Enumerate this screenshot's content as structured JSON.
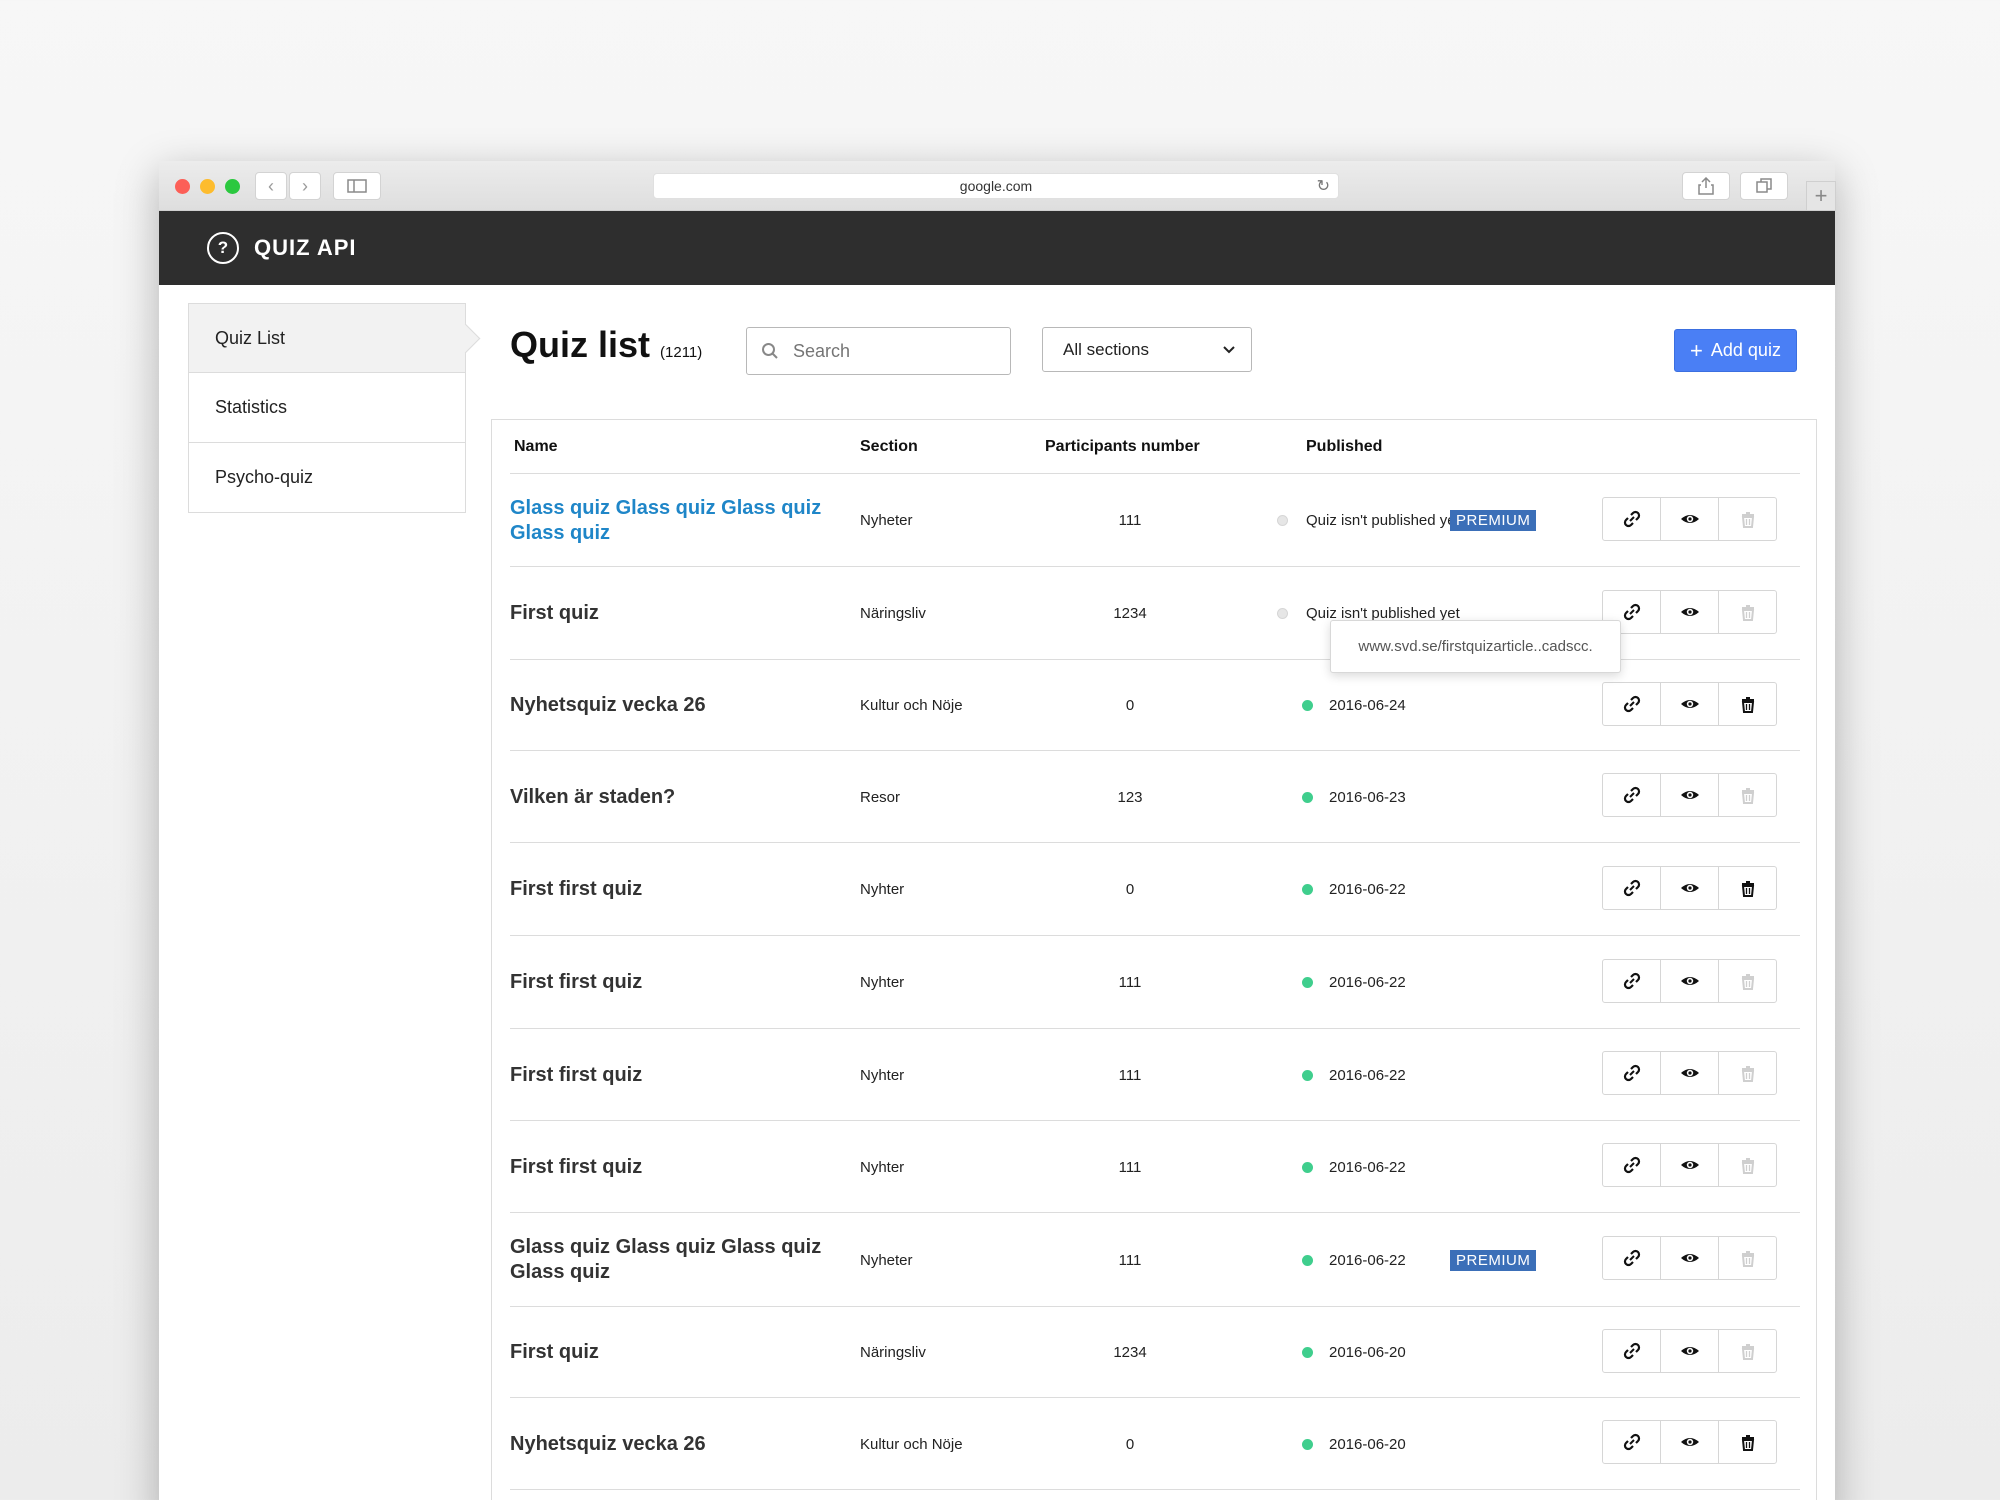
{
  "browser": {
    "url": "google.com"
  },
  "app": {
    "title": "QUIZ API",
    "logo_icon": "question-circle-icon"
  },
  "sidebar": {
    "items": [
      {
        "label": "Quiz List",
        "active": true
      },
      {
        "label": "Statistics",
        "active": false
      },
      {
        "label": "Psycho-quiz",
        "active": false
      }
    ]
  },
  "header": {
    "title": "Quiz list",
    "count": "(1211)",
    "search_placeholder": "Search",
    "section_filter": "All sections",
    "add_label": "Add quiz"
  },
  "table": {
    "columns": [
      "Name",
      "Section",
      "Participants number",
      "Published"
    ],
    "rows": [
      {
        "name": "Glass quiz Glass quiz Glass quiz Glass quiz",
        "section": "Nyheter",
        "participants": "111",
        "published": "Quiz isn't published yet",
        "status": "unpublished",
        "premium": "PREMIUM",
        "highlight": true,
        "delete_enabled": false
      },
      {
        "name": "First quiz",
        "section": "Näringsliv",
        "participants": "1234",
        "published": "Quiz isn't published yet",
        "status": "unpublished",
        "premium": "",
        "highlight": false,
        "delete_enabled": false
      },
      {
        "name": "Nyhetsquiz vecka 26",
        "section": "Kultur och Nöje",
        "participants": "0",
        "published": "2016-06-24",
        "status": "published",
        "premium": "",
        "highlight": false,
        "delete_enabled": true
      },
      {
        "name": "Vilken är staden?",
        "section": "Resor",
        "participants": "123",
        "published": "2016-06-23",
        "status": "published",
        "premium": "",
        "highlight": false,
        "delete_enabled": false
      },
      {
        "name": "First first quiz",
        "section": "Nyhter",
        "participants": "0",
        "published": "2016-06-22",
        "status": "published",
        "premium": "",
        "highlight": false,
        "delete_enabled": true
      },
      {
        "name": "First first quiz",
        "section": "Nyhter",
        "participants": "111",
        "published": "2016-06-22",
        "status": "published",
        "premium": "",
        "highlight": false,
        "delete_enabled": false
      },
      {
        "name": "First first quiz",
        "section": "Nyhter",
        "participants": "111",
        "published": "2016-06-22",
        "status": "published",
        "premium": "",
        "highlight": false,
        "delete_enabled": false
      },
      {
        "name": "First first quiz",
        "section": "Nyhter",
        "participants": "111",
        "published": "2016-06-22",
        "status": "published",
        "premium": "",
        "highlight": false,
        "delete_enabled": false
      },
      {
        "name": "Glass quiz Glass quiz Glass quiz Glass quiz",
        "section": "Nyheter",
        "participants": "111",
        "published": "2016-06-22",
        "status": "published",
        "premium": "PREMIUM",
        "highlight": false,
        "delete_enabled": false
      },
      {
        "name": "First quiz",
        "section": "Näringsliv",
        "participants": "1234",
        "published": "2016-06-20",
        "status": "published",
        "premium": "",
        "highlight": false,
        "delete_enabled": false
      },
      {
        "name": "Nyhetsquiz vecka 26",
        "section": "Kultur och Nöje",
        "participants": "0",
        "published": "2016-06-20",
        "status": "published",
        "premium": "",
        "highlight": false,
        "delete_enabled": true
      }
    ]
  },
  "tooltip": {
    "text": "www.svd.se/firstquizarticle..cadscc."
  },
  "colors": {
    "accent": "#4a7ff5",
    "link": "#1f86c8",
    "published_dot": "#3fce8d",
    "premium_bg": "#3b6fb8",
    "appbar": "#2e2e2e"
  }
}
